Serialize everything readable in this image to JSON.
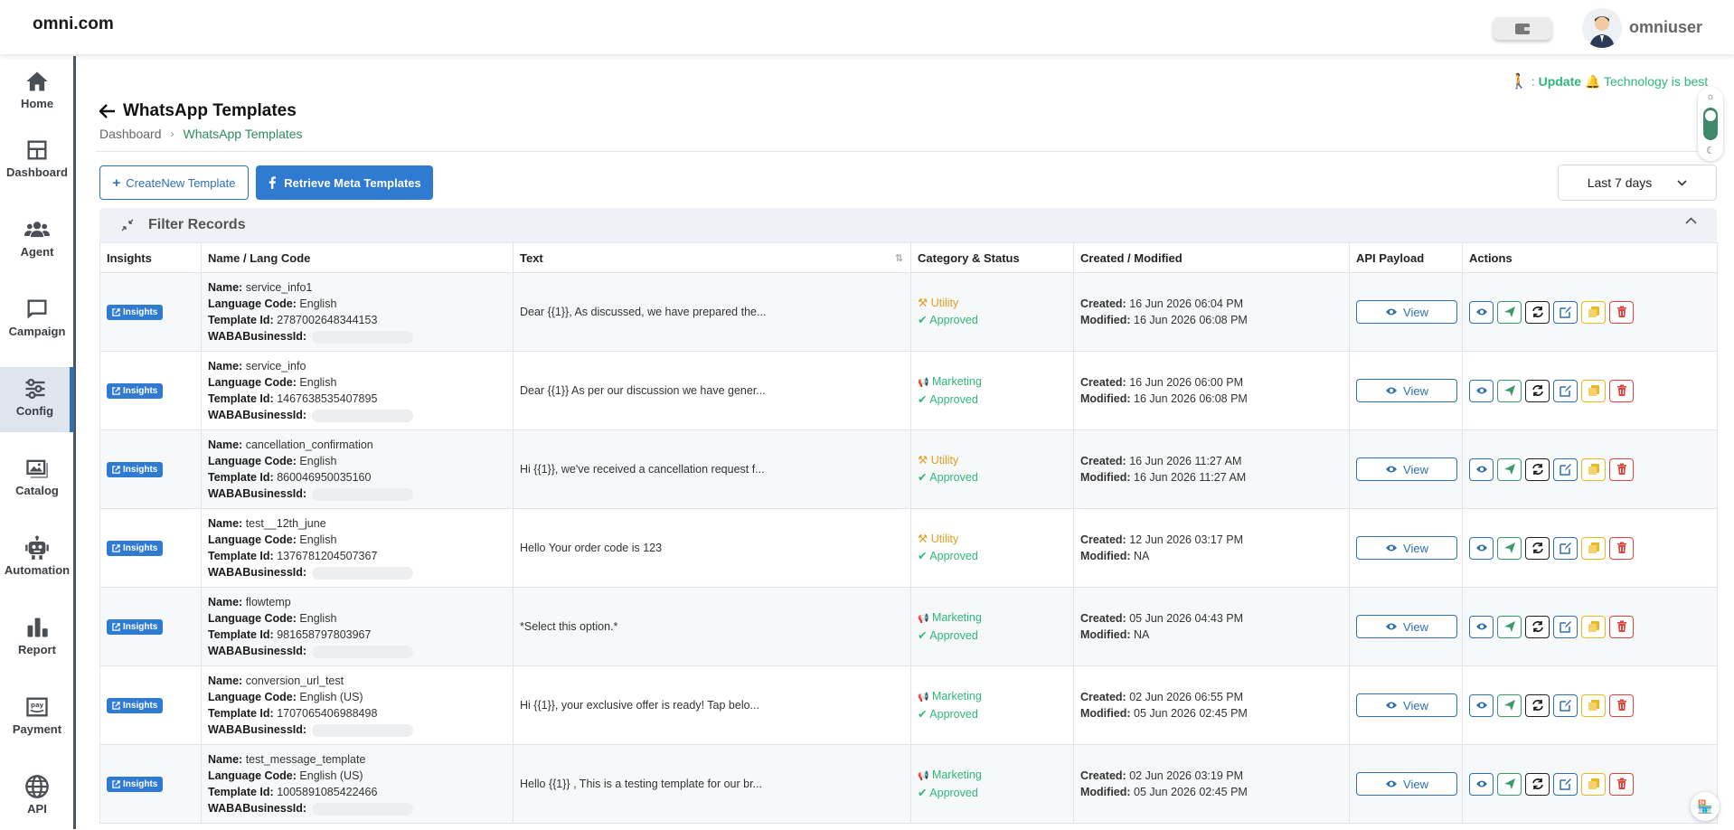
{
  "brand": "omni.com",
  "user": {
    "name": "omniuser"
  },
  "sidebar": [
    {
      "label": "Home",
      "icon": "home-icon"
    },
    {
      "label": "Dashboard",
      "icon": "dashboard-icon"
    },
    {
      "label": "Agent",
      "icon": "agent-icon"
    },
    {
      "label": "Campaign",
      "icon": "campaign-icon"
    },
    {
      "label": "Config",
      "icon": "config-icon",
      "active": true
    },
    {
      "label": "Catalog",
      "icon": "catalog-icon"
    },
    {
      "label": "Automation",
      "icon": "automation-icon"
    },
    {
      "label": "Report",
      "icon": "report-icon"
    },
    {
      "label": "Payment",
      "icon": "payment-icon"
    },
    {
      "label": "API",
      "icon": "api-icon"
    }
  ],
  "promo": {
    "prefix": ": ",
    "bold": "Update",
    "rest": " Technology is best wh"
  },
  "page": {
    "title": "WhatsApp Templates",
    "breadcrumb": {
      "home": "Dashboard",
      "current": "WhatsApp Templates"
    }
  },
  "toolbar": {
    "create_label": "CreateNew Template",
    "retrieve_label": "Retrieve Meta Templates",
    "range_label": "Last 7 days"
  },
  "filter": {
    "title": "Filter Records"
  },
  "table": {
    "headers": [
      "Insights",
      "Name / Lang Code",
      "Text",
      "Category & Status",
      "Created / Modified",
      "API Payload",
      "Actions"
    ],
    "labels": {
      "insights": "Insights",
      "name": "Name:",
      "lang": "Language Code:",
      "tid": "Template Id:",
      "waba": "WABABusinessId:",
      "created": "Created:",
      "modified": "Modified:",
      "view": "View"
    },
    "rows": [
      {
        "name": "service_info1",
        "lang": "English",
        "tid": "2787002648344153",
        "text": "Dear {{1}}, As discussed, we have prepared the...",
        "category": "Utility",
        "status": "Approved",
        "created": "16 Jun 2026 06:04 PM",
        "modified": "16 Jun 2026 06:08 PM"
      },
      {
        "name": "service_info",
        "lang": "English",
        "tid": "1467638535407895",
        "text": "Dear {{1}} As per our discussion we have gener...",
        "category": "Marketing",
        "status": "Approved",
        "created": "16 Jun 2026 06:00 PM",
        "modified": "16 Jun 2026 06:08 PM"
      },
      {
        "name": "cancellation_confirmation",
        "lang": "English",
        "tid": "860046950035160",
        "text": "Hi {{1}}, we've received a cancellation request f...",
        "category": "Utility",
        "status": "Approved",
        "created": "16 Jun 2026 11:27 AM",
        "modified": "16 Jun 2026 11:27 AM"
      },
      {
        "name": "test__12th_june",
        "lang": "English",
        "tid": "1376781204507367",
        "text": "Hello Your order code is 123",
        "category": "Utility",
        "status": "Approved",
        "created": "12 Jun 2026 03:17 PM",
        "modified": "NA"
      },
      {
        "name": "flowtemp",
        "lang": "English",
        "tid": "981658797803967",
        "text": "*Select this option.*",
        "category": "Marketing",
        "status": "Approved",
        "created": "05 Jun 2026 04:43 PM",
        "modified": "NA"
      },
      {
        "name": "conversion_url_test",
        "lang": "English (US)",
        "tid": "1707065406988498",
        "text": "Hi {{1}}, your exclusive offer is ready! Tap belo...",
        "category": "Marketing",
        "status": "Approved",
        "created": "02 Jun 2026 06:55 PM",
        "modified": "05 Jun 2026 02:45 PM"
      },
      {
        "name": "test_message_template",
        "lang": "English (US)",
        "tid": "1005891085422466",
        "text": "Hello {{1}} , This is a testing template for our br...",
        "category": "Marketing",
        "status": "Approved",
        "created": "02 Jun 2026 03:19 PM",
        "modified": "05 Jun 2026 02:45 PM"
      }
    ]
  },
  "colors": {
    "primary": "#2f7bd1",
    "green": "#2db87a",
    "utility": "#e0a022",
    "danger": "#e0443b"
  }
}
